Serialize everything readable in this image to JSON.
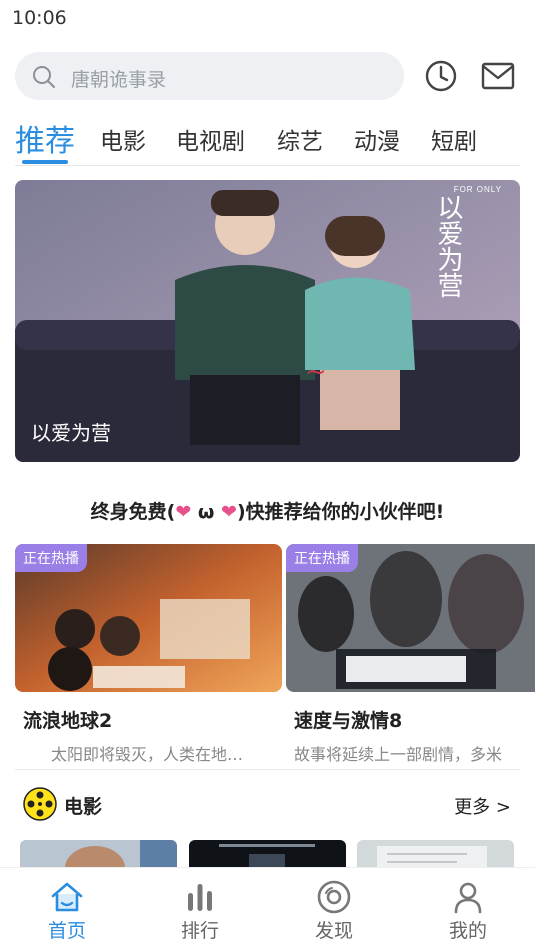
{
  "status_bar": {
    "time": "10:06"
  },
  "search": {
    "placeholder": "唐朝诡事录"
  },
  "header_icons": {
    "history": "history-clock-icon",
    "messages": "mail-icon"
  },
  "tabs": [
    {
      "label": "推荐",
      "active": true
    },
    {
      "label": "电影",
      "active": false
    },
    {
      "label": "电视剧",
      "active": false
    },
    {
      "label": "综艺",
      "active": false
    },
    {
      "label": "动漫",
      "active": false
    },
    {
      "label": "短剧",
      "active": false
    }
  ],
  "banner": {
    "caption": "以爱为营",
    "logo_text": "以爱为营",
    "logo_small": "FOR ONLY"
  },
  "promo": {
    "prefix": "终身免费(",
    "heart": "❤",
    "middle": " ω ",
    "suffix": ")快推荐给你的小伙伴吧!"
  },
  "hot_now": [
    {
      "badge": "正在热播",
      "title": "流浪地球2",
      "desc": "太阳即将毁灭，人类在地…"
    },
    {
      "badge": "正在热播",
      "title": "速度与激情8",
      "desc": "故事将延续上一部剧情，多米"
    }
  ],
  "section": {
    "title": "电影",
    "more": "更多 >"
  },
  "bottom_nav": [
    {
      "label": "首页",
      "icon": "home-icon",
      "active": true
    },
    {
      "label": "排行",
      "icon": "ranking-bars-icon",
      "active": false
    },
    {
      "label": "发现",
      "icon": "discover-disc-icon",
      "active": false
    },
    {
      "label": "我的",
      "icon": "profile-person-icon",
      "active": false
    }
  ],
  "colors": {
    "accent": "#2b8de0",
    "badge": "#9a7fe6",
    "heart": "#e8508c"
  }
}
